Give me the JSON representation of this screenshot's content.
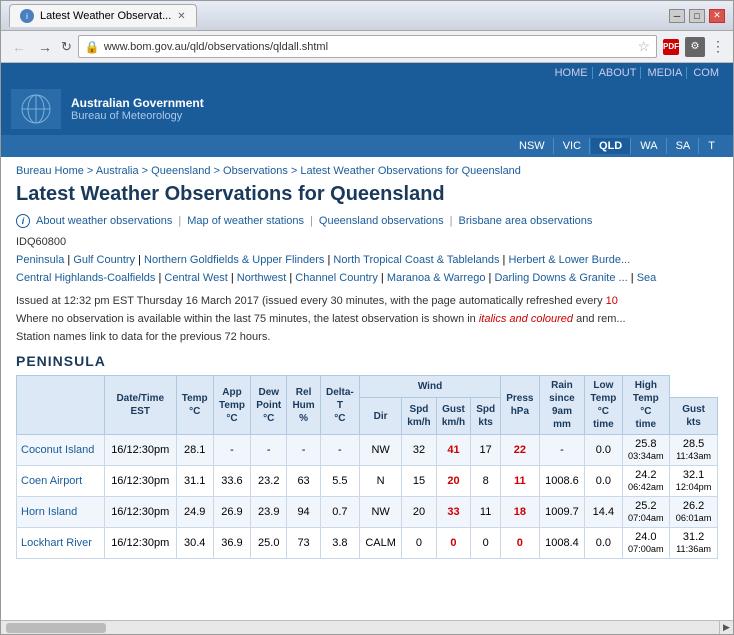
{
  "browser": {
    "tab_title": "Latest Weather Observat...",
    "url": "www.bom.gov.au/qld/observations/qldall.shtml",
    "favicon_letter": "i"
  },
  "bom": {
    "gov_title": "Australian Government",
    "bureau_title": "Bureau of Meteorology",
    "top_nav": [
      "HOME",
      "ABOUT",
      "MEDIA",
      "COM"
    ],
    "state_nav": [
      "NSW",
      "VIC",
      "QLD",
      "WA",
      "SA",
      "T"
    ]
  },
  "breadcrumb": {
    "items": [
      "Bureau Home",
      "Australia",
      "Queensland",
      "Observations"
    ],
    "current": "Latest Weather Observations for Queensland"
  },
  "page": {
    "title": "Latest Weather Observations for Queensland",
    "info_links": [
      "About weather observations",
      "Map of weather stations",
      "Queensland observations",
      "Brisbane area observations"
    ],
    "idq": "IDQ60800",
    "region_links": [
      "Peninsula",
      "Gulf Country",
      "Northern Goldfields & Upper Flinders",
      "North Tropical Coast & Tablelands",
      "Herbert & Lower Burde...",
      "Central Highlands-Coalfields",
      "Central West",
      "Northwest",
      "Channel Country",
      "Maranoa & Warrego",
      "Darling Downs & Granite ...",
      "Sea"
    ],
    "issued_text": "Issued at 12:32 pm EST Thursday 16 March 2017 (issued every 30 minutes, with the page automatically refreshed every 10",
    "obs_text_1": "Where no observation is available within the last 75 minutes, the latest observation is shown in",
    "obs_text_italic": "italics and coloured",
    "obs_text_2": "and rem...",
    "station_text": "Station names link to data for the previous 72 hours."
  },
  "peninsula": {
    "section_title": "PENINSULA",
    "table_headers": {
      "station": "",
      "datetime": "Date/Time EST",
      "temp": "Temp °C",
      "app_temp": "App Temp °C",
      "dew_point": "Dew Point °C",
      "rel_hum": "Rel Hum %",
      "delta_t": "Delta-T °C",
      "wind_group": "Wind",
      "wind_dir": "Dir",
      "wind_spd": "Spd km/h",
      "wind_gust": "Gust km/h",
      "wind_spd2": "Spd kts",
      "wind_gust2": "Gust kts",
      "press": "Press hPa",
      "rain": "Rain since 9am mm",
      "low_temp": "Low Temp °C time",
      "high_temp": "High Temp °C time"
    },
    "rows": [
      {
        "station": "Coconut Island",
        "datetime": "16/12:30pm",
        "temp": "28.1",
        "app_temp": "-",
        "dew_point": "-",
        "rel_hum": "-",
        "delta_t": "-",
        "wind_dir": "NW",
        "wind_spd": "32",
        "wind_gust": "41",
        "wind_spd_h": "41",
        "wind_spd2": "17",
        "wind_gust2": "22",
        "wind_gust_h": "22",
        "press": "-",
        "rain": "0.0",
        "low_temp": "25.8",
        "low_time": "03:34am",
        "high_temp": "28.5",
        "high_time": "11:43am"
      },
      {
        "station": "Coen Airport",
        "datetime": "16/12:30pm",
        "temp": "31.1",
        "app_temp": "33.6",
        "dew_point": "23.2",
        "rel_hum": "63",
        "delta_t": "5.5",
        "wind_dir": "N",
        "wind_spd": "15",
        "wind_gust": "20",
        "wind_spd_h": "20",
        "wind_spd2": "8",
        "wind_gust2": "11",
        "wind_gust_h": "11",
        "press": "1008.6",
        "rain": "0.0",
        "low_temp": "24.2",
        "low_time": "06:42am",
        "high_temp": "32.1",
        "high_time": "12:04pm"
      },
      {
        "station": "Horn Island",
        "datetime": "16/12:30pm",
        "temp": "24.9",
        "app_temp": "26.9",
        "dew_point": "23.9",
        "rel_hum": "94",
        "delta_t": "0.7",
        "wind_dir": "NW",
        "wind_spd": "20",
        "wind_gust": "33",
        "wind_spd_h": "33",
        "wind_spd2": "11",
        "wind_gust2": "18",
        "wind_gust_h": "18",
        "press": "1009.7",
        "rain": "14.4",
        "low_temp": "25.2",
        "low_time": "07:04am",
        "high_temp": "26.2",
        "high_time": "06:01am"
      },
      {
        "station": "Lockhart River",
        "datetime": "16/12:30pm",
        "temp": "30.4",
        "app_temp": "36.9",
        "dew_point": "25.0",
        "rel_hum": "73",
        "delta_t": "3.8",
        "wind_dir": "CALM",
        "wind_spd": "0",
        "wind_gust": "0",
        "wind_spd_h": "0",
        "wind_spd2": "0",
        "wind_gust2": "0",
        "wind_gust_h": "0",
        "press": "1008.4",
        "rain": "0.0",
        "low_temp": "24.0",
        "low_time": "07:00am",
        "high_temp": "31.2",
        "high_time": "11:36am"
      }
    ]
  }
}
